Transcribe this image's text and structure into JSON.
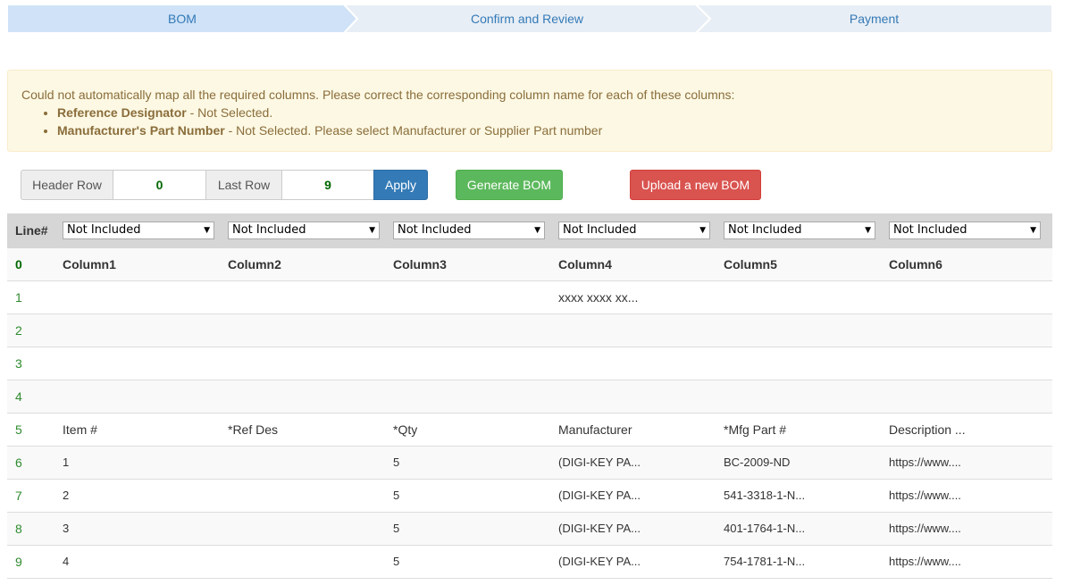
{
  "steps": [
    {
      "label": "BOM",
      "active": true
    },
    {
      "label": "Confirm and Review",
      "active": false
    },
    {
      "label": "Payment",
      "active": false
    }
  ],
  "alert": {
    "message": "Could not automatically map all the required columns. Please correct the corresponding column name for each of these columns:",
    "items": [
      {
        "name": "Reference Designator",
        "detail": " - Not Selected."
      },
      {
        "name": "Manufacturer's Part Number",
        "detail": " - Not Selected. Please select Manufacturer or Supplier Part number"
      }
    ]
  },
  "controls": {
    "header_row_label": "Header Row",
    "header_row_value": "0",
    "last_row_label": "Last Row",
    "last_row_value": "9",
    "apply_label": "Apply",
    "generate_label": "Generate BOM",
    "upload_label": "Upload a new BOM"
  },
  "table": {
    "line_header": "Line#",
    "selects": [
      "Not Included",
      "Not Included",
      "Not Included",
      "Not Included",
      "Not Included",
      "Not Included"
    ],
    "rows": [
      {
        "line": "0",
        "cells": [
          "Column1",
          "Column2",
          "Column3",
          "Column4",
          "Column5",
          "Column6"
        ]
      },
      {
        "line": "1",
        "cells": [
          "",
          "",
          "",
          "xxxx xxxx xx...",
          "",
          ""
        ]
      },
      {
        "line": "2",
        "cells": [
          "",
          "",
          "",
          "",
          "",
          ""
        ]
      },
      {
        "line": "3",
        "cells": [
          "",
          "",
          "",
          "",
          "",
          ""
        ]
      },
      {
        "line": "4",
        "cells": [
          "",
          "",
          "",
          "",
          "",
          ""
        ]
      },
      {
        "line": "5",
        "cells": [
          "Item #",
          "*Ref Des",
          "*Qty",
          "Manufacturer",
          "*Mfg Part #",
          "Description ..."
        ]
      },
      {
        "line": "6",
        "cells": [
          "1",
          "",
          "5",
          "(DIGI-KEY PA...",
          "BC-2009-ND",
          "https://www...."
        ]
      },
      {
        "line": "7",
        "cells": [
          "2",
          "",
          "5",
          "(DIGI-KEY PA...",
          "541-3318-1-N...",
          "https://www...."
        ]
      },
      {
        "line": "8",
        "cells": [
          "3",
          "",
          "5",
          "(DIGI-KEY PA...",
          "401-1764-1-N...",
          "https://www...."
        ]
      },
      {
        "line": "9",
        "cells": [
          "4",
          "",
          "5",
          "(DIGI-KEY PA...",
          "754-1781-1-N...",
          "https://www...."
        ]
      }
    ]
  },
  "colors": {
    "step_active": "#cfe2f7",
    "step_inactive": "#e8eef5",
    "link": "#337ab7",
    "alert_bg": "#fcf8e3",
    "line_number": "#2e8b2e"
  }
}
